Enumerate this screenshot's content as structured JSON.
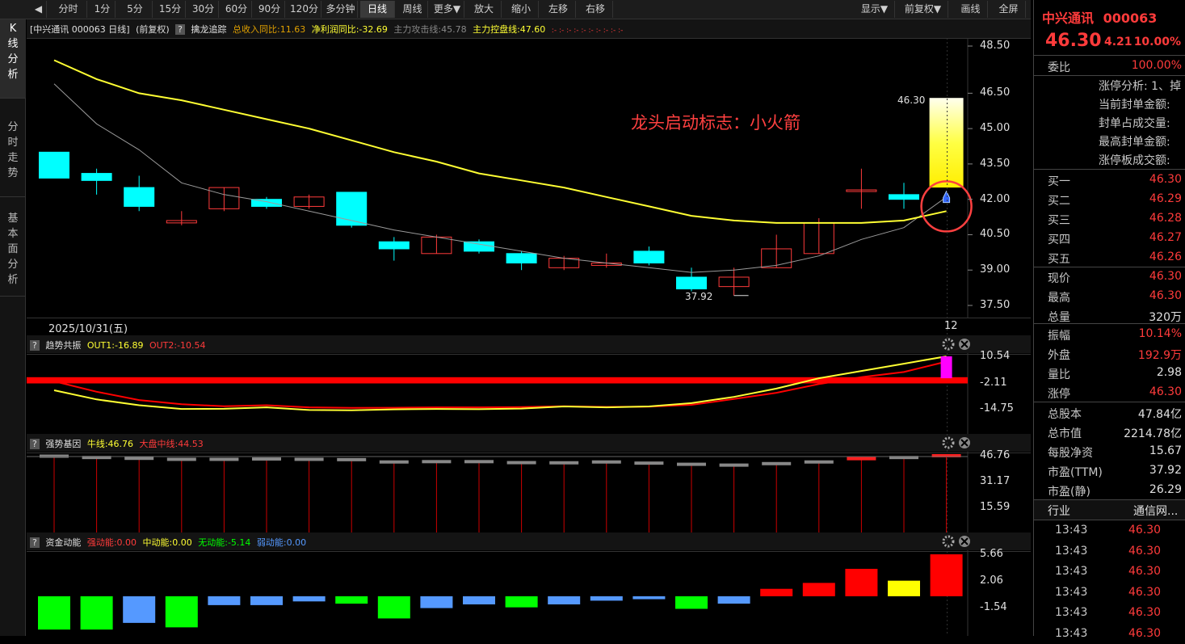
{
  "toolbar": {
    "back_label": "◀",
    "periods": [
      "分时",
      "1分",
      "5分",
      "15分",
      "30分",
      "60分",
      "90分",
      "120分",
      "多分钟",
      "日线",
      "周线",
      "更多▼",
      "放大",
      "缩小",
      "左移",
      "右移"
    ],
    "active_period": "日线",
    "right_buttons": [
      "显示▼",
      "前复权▼",
      "画线",
      "全屏"
    ]
  },
  "leftnav": [
    "K线分析",
    "分时走势",
    "基本面分析"
  ],
  "main_panel": {
    "title_name": "[中兴通讯 000063 日线]",
    "title_adjust": "(前复权)",
    "help": "?",
    "indicator_name": "擒龙追踪",
    "revenue_label": "总收入同比:11.63",
    "profit_label": "净利润同比:-32.69",
    "attack_label": "主力攻击线:45.78",
    "control_label": "主力控盘线:47.60",
    "dots": ":- :- :- :- :- :- :- :- :- :-",
    "annotation": "龙头启动标志：小火箭",
    "high_label": "46.30",
    "low_label": "37.92",
    "date_label": "2025/10/31(五)",
    "last_label": "12",
    "y_ticks": [
      "48.50",
      "46.50",
      "45.00",
      "43.50",
      "42.00",
      "40.50",
      "39.00",
      "37.50"
    ]
  },
  "panel2": {
    "name": "趋势共振",
    "out1": "OUT1:-16.89",
    "out2": "OUT2:-10.54",
    "y_ticks": [
      "10.54",
      "-2.11",
      "-14.75"
    ]
  },
  "panel3": {
    "name": "强势基因",
    "bull": "牛线:46.76",
    "market": "大盘中线:44.53",
    "y_ticks": [
      "46.76",
      "31.17",
      "15.59"
    ]
  },
  "panel4": {
    "name": "资金动能",
    "strong": "强动能:0.00",
    "mid": "中动能:0.00",
    "none": "无动能:-5.14",
    "weak": "弱动能:0.00",
    "y_ticks": [
      "5.66",
      "2.06",
      "-1.54"
    ]
  },
  "colors": {
    "up": "#ff3b3b",
    "down": "#00ffff",
    "ma_yellow": "#ffff33",
    "ma_gray": "#9a9a9a",
    "green": "#00ff00",
    "blue": "#5599ff",
    "magenta": "#ff00ff"
  },
  "chart_data": {
    "type": "candlestick",
    "candles": [
      {
        "o": 44.0,
        "h": 44.0,
        "l": 42.9,
        "c": 42.9
      },
      {
        "o": 43.1,
        "h": 43.3,
        "l": 42.2,
        "c": 42.8
      },
      {
        "o": 42.5,
        "h": 43.0,
        "l": 41.5,
        "c": 41.7
      },
      {
        "o": 41.0,
        "h": 41.5,
        "l": 40.9,
        "c": 41.1
      },
      {
        "o": 41.6,
        "h": 42.5,
        "l": 41.5,
        "c": 42.5
      },
      {
        "o": 42.0,
        "h": 42.1,
        "l": 41.6,
        "c": 41.7
      },
      {
        "o": 41.7,
        "h": 42.2,
        "l": 41.6,
        "c": 42.1
      },
      {
        "o": 42.3,
        "h": 42.3,
        "l": 40.8,
        "c": 40.9
      },
      {
        "o": 40.2,
        "h": 40.4,
        "l": 39.4,
        "c": 39.9
      },
      {
        "o": 39.7,
        "h": 40.5,
        "l": 39.7,
        "c": 40.4
      },
      {
        "o": 40.2,
        "h": 40.3,
        "l": 39.7,
        "c": 39.8
      },
      {
        "o": 39.7,
        "h": 39.8,
        "l": 39.0,
        "c": 39.3
      },
      {
        "o": 39.1,
        "h": 39.6,
        "l": 39.0,
        "c": 39.5
      },
      {
        "o": 39.2,
        "h": 39.7,
        "l": 39.1,
        "c": 39.3
      },
      {
        "o": 39.8,
        "h": 40.0,
        "l": 39.2,
        "c": 39.3
      },
      {
        "o": 38.7,
        "h": 39.1,
        "l": 38.1,
        "c": 38.2
      },
      {
        "o": 38.3,
        "h": 39.1,
        "l": 37.92,
        "c": 38.7
      },
      {
        "o": 39.1,
        "h": 40.5,
        "l": 39.1,
        "c": 39.9
      },
      {
        "o": 39.7,
        "h": 41.2,
        "l": 39.7,
        "c": 41.0
      },
      {
        "o": 42.4,
        "h": 43.3,
        "l": 41.6,
        "c": 42.4
      },
      {
        "o": 42.2,
        "h": 42.7,
        "l": 41.6,
        "c": 42.0
      },
      {
        "o": 42.5,
        "h": 46.3,
        "l": 42.5,
        "c": 46.3
      }
    ],
    "ma_yellow": [
      47.9,
      47.1,
      46.5,
      46.2,
      45.8,
      45.4,
      45.0,
      44.5,
      44.0,
      43.6,
      43.1,
      42.8,
      42.5,
      42.1,
      41.7,
      41.3,
      41.1,
      41.0,
      41.0,
      41.0,
      41.1,
      41.5
    ],
    "ma_gray": [
      46.9,
      45.2,
      44.1,
      42.7,
      42.2,
      41.9,
      41.5,
      41.1,
      40.7,
      40.4,
      40.1,
      39.8,
      39.5,
      39.3,
      39.1,
      38.9,
      39.0,
      39.2,
      39.6,
      40.3,
      40.8,
      42.1
    ],
    "trend_out1": [
      -5.8,
      -10.2,
      -13.0,
      -14.8,
      -14.7,
      -14.0,
      -15.3,
      -15.4,
      -15.0,
      -14.8,
      -14.9,
      -14.6,
      -13.6,
      -14.0,
      -13.6,
      -12.0,
      -9.0,
      -5.0,
      0.0,
      3.5,
      7.0,
      10.54
    ],
    "trend_out2": [
      -1.5,
      -6.5,
      -10.5,
      -12.5,
      -13.5,
      -13.0,
      -14.0,
      -14.3,
      -14.2,
      -14.0,
      -14.0,
      -13.9,
      -13.5,
      -13.8,
      -13.7,
      -12.8,
      -10.0,
      -7.0,
      -2.8,
      0.5,
      3.0,
      8.0
    ],
    "gene_bull": [
      46.5,
      45.7,
      45.2,
      44.6,
      44.6,
      44.8,
      44.6,
      44.4,
      43.0,
      43.2,
      43.2,
      42.6,
      42.5,
      43.0,
      42.3,
      41.6,
      41.1,
      42.0,
      43.0,
      45.0,
      45.7,
      46.76
    ],
    "gene_market": 44.53,
    "fund": [
      -4.5,
      -4.5,
      -3.6,
      -4.2,
      -1.2,
      -1.2,
      -0.7,
      -1.0,
      -3.0,
      -1.6,
      -1.1,
      -1.5,
      -1.1,
      -0.6,
      -0.4,
      -1.7,
      -1.0,
      1.0,
      1.8,
      3.7,
      2.1,
      5.66
    ],
    "fund_colors": [
      "green",
      "green",
      "blue",
      "green",
      "blue",
      "blue",
      "blue",
      "green",
      "green",
      "blue",
      "blue",
      "green",
      "blue",
      "blue",
      "blue",
      "green",
      "blue",
      "up",
      "up",
      "up",
      "yellow",
      "up"
    ]
  },
  "right_panel": {
    "stock_name": "中兴通讯",
    "stock_code": "000063",
    "price": "46.30",
    "change": "4.21",
    "change_pct": "10.00%",
    "weibi_label": "委比",
    "weibi_value": "100.00%",
    "limit_labels": [
      "涨停分析: 1、掉",
      "当前封单金额:",
      "封单占成交量:",
      "最高封单金额:",
      "涨停板成交额:"
    ],
    "bids": [
      {
        "label": "买一",
        "value": "46.30"
      },
      {
        "label": "买二",
        "value": "46.29"
      },
      {
        "label": "买三",
        "value": "46.28"
      },
      {
        "label": "买四",
        "value": "46.27"
      },
      {
        "label": "买五",
        "value": "46.26"
      }
    ],
    "quote": [
      {
        "label": "现价",
        "value": "46.30",
        "cls": "up"
      },
      {
        "label": "最高",
        "value": "46.30",
        "cls": "up"
      },
      {
        "label": "总量",
        "value": "320万",
        "cls": "wh"
      }
    ],
    "stats": [
      {
        "label": "振幅",
        "value": "10.14%",
        "cls": "up"
      },
      {
        "label": "外盘",
        "value": "192.9万",
        "cls": "up"
      },
      {
        "label": "量比",
        "value": "2.98",
        "cls": "wh"
      },
      {
        "label": "涨停",
        "value": "46.30",
        "cls": "up"
      }
    ],
    "fund": [
      {
        "label": "总股本",
        "value": "47.84亿"
      },
      {
        "label": "总市值",
        "value": "2214.78亿"
      },
      {
        "label": "每股净资",
        "value": "15.67"
      },
      {
        "label": "市盈(TTM)",
        "value": "37.92"
      },
      {
        "label": "市盈(静)",
        "value": "26.29"
      }
    ],
    "industry_label": "行业",
    "industry_value": "通信网...",
    "ticks": [
      {
        "time": "13:43",
        "price": "46.30"
      },
      {
        "time": "13:43",
        "price": "46.30"
      },
      {
        "time": "13:43",
        "price": "46.30"
      },
      {
        "time": "13:43",
        "price": "46.30"
      },
      {
        "time": "13:43",
        "price": "46.30"
      },
      {
        "time": "13:43",
        "price": "46.30"
      }
    ]
  }
}
